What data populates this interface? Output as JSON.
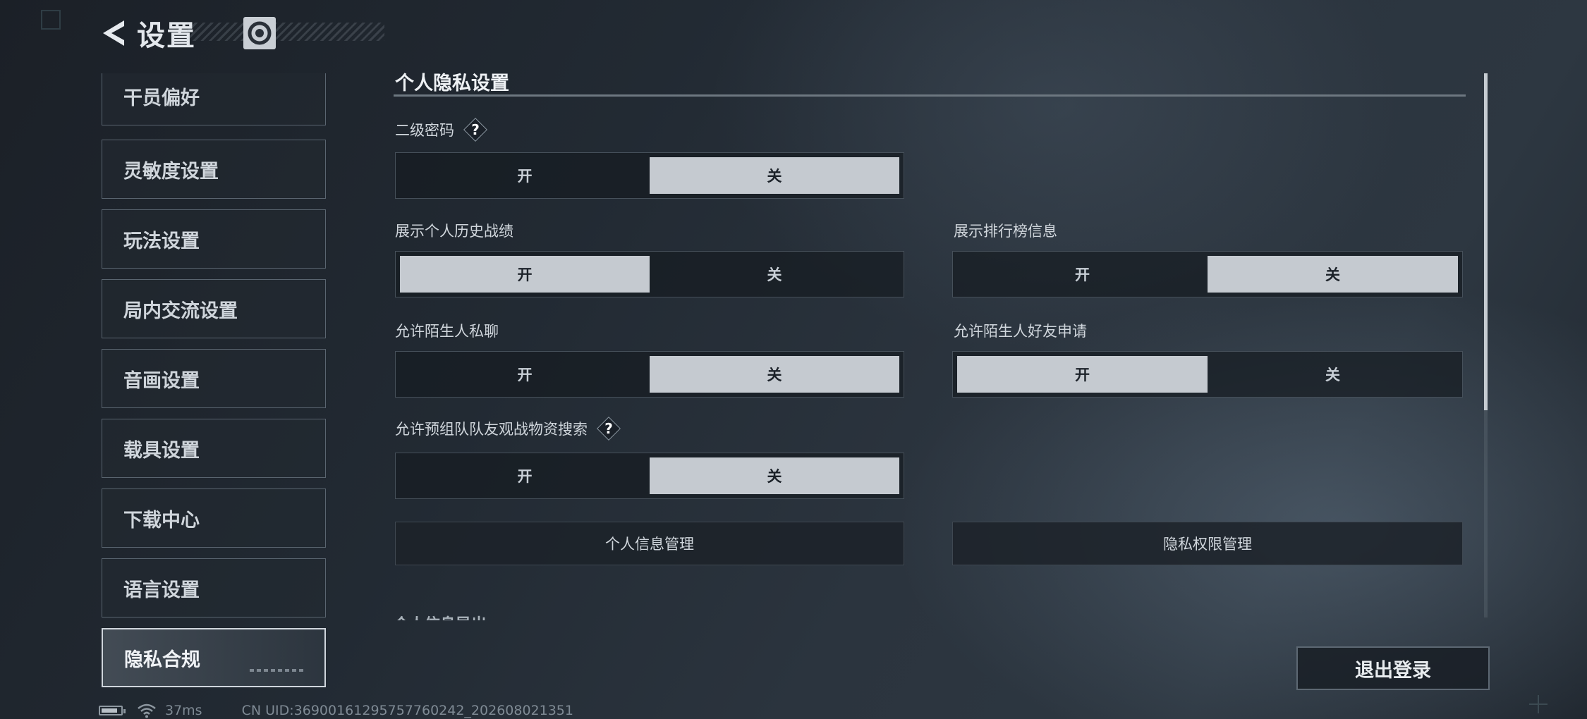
{
  "header": {
    "title": "设置"
  },
  "sidebar": {
    "items": [
      {
        "label": "干员偏好"
      },
      {
        "label": "灵敏度设置"
      },
      {
        "label": "玩法设置"
      },
      {
        "label": "局内交流设置"
      },
      {
        "label": "音画设置"
      },
      {
        "label": "载具设置"
      },
      {
        "label": "下载中心"
      },
      {
        "label": "语言设置"
      },
      {
        "label": "隐私合规",
        "active": true
      }
    ]
  },
  "section": {
    "title": "个人隐私设置"
  },
  "settings": {
    "secondary_password": {
      "label": "二级密码",
      "help": "?",
      "on": "开",
      "off": "关",
      "value": "关"
    },
    "show_history": {
      "label": "展示个人历史战绩",
      "on": "开",
      "off": "关",
      "value": "开"
    },
    "show_leaderboard": {
      "label": "展示排行榜信息",
      "on": "开",
      "off": "关",
      "value": "关"
    },
    "stranger_chat": {
      "label": "允许陌生人私聊",
      "on": "开",
      "off": "关",
      "value": "关"
    },
    "stranger_friend": {
      "label": "允许陌生人好友申请",
      "on": "开",
      "off": "关",
      "value": "开"
    },
    "team_spectate": {
      "label": "允许预组队队友观战物资搜索",
      "help": "?",
      "on": "开",
      "off": "关",
      "value": "关"
    }
  },
  "buttons": {
    "personal_info": "个人信息管理",
    "privacy_permission": "隐私权限管理",
    "logout": "退出登录"
  },
  "cut_off_heading": "个人信息导出",
  "status": {
    "ping": "37ms",
    "uid": "CN UID:36900161295757760242_202608021351"
  },
  "colors": {
    "selected": "#c5cad0",
    "background": "#222a33",
    "accent": "#eef1f4"
  }
}
